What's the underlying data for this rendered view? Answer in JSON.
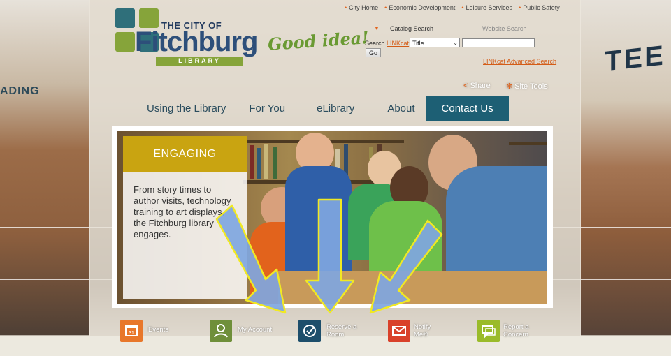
{
  "logo": {
    "line1": "THE CITY OF",
    "line2": "Fitchburg",
    "sub": "LIBRARY",
    "tagline": "Good idea!"
  },
  "top_links": [
    "City Home",
    "Economic Development",
    "Leisure Services",
    "Public Safety"
  ],
  "search": {
    "tab_catalog": "Catalog Search",
    "tab_website": "Website Search",
    "label_prefix": "Search",
    "label_link": "LINKcat",
    "label_suffix": ":",
    "select_value": "Title",
    "input_value": "",
    "go_label": "Go",
    "advanced_label": "LINKcat Advanced Search"
  },
  "utilities": {
    "share": "Share",
    "site_tools": "Site Tools"
  },
  "nav": [
    {
      "label": "Using the Library"
    },
    {
      "label": "For You"
    },
    {
      "label": "eLibrary"
    },
    {
      "label": "About"
    },
    {
      "label": "Contact Us",
      "active": true
    }
  ],
  "hero": {
    "heading": "ENGAGING",
    "text": "From story times to author visits, technology training to art displays, the Fitchburg library engages."
  },
  "background_signs": {
    "left": "ADING",
    "right": "TEE"
  },
  "quick_links": [
    {
      "line1": "Events",
      "line2": "",
      "icon": "calendar-icon",
      "color": "#e8772a"
    },
    {
      "line1": "My Account",
      "line2": "",
      "icon": "person-icon",
      "color": "#6f8f3a"
    },
    {
      "line1": "Reserve a",
      "line2": "Room",
      "icon": "check-icon",
      "color": "#1d4e6b"
    },
    {
      "line1": "Notify",
      "line2": "Me®",
      "icon": "envelope-icon",
      "color": "#d9412a"
    },
    {
      "line1": "Report a",
      "line2": "Concern",
      "icon": "speech-bubble-icon",
      "color": "#9abb2a"
    }
  ],
  "colors": {
    "accent": "#1d5f74",
    "orange": "#e2631c",
    "green": "#86a43a",
    "gold": "#c9a411",
    "arrow": "#7fa6e0",
    "arrow_outline": "#f1e922"
  }
}
